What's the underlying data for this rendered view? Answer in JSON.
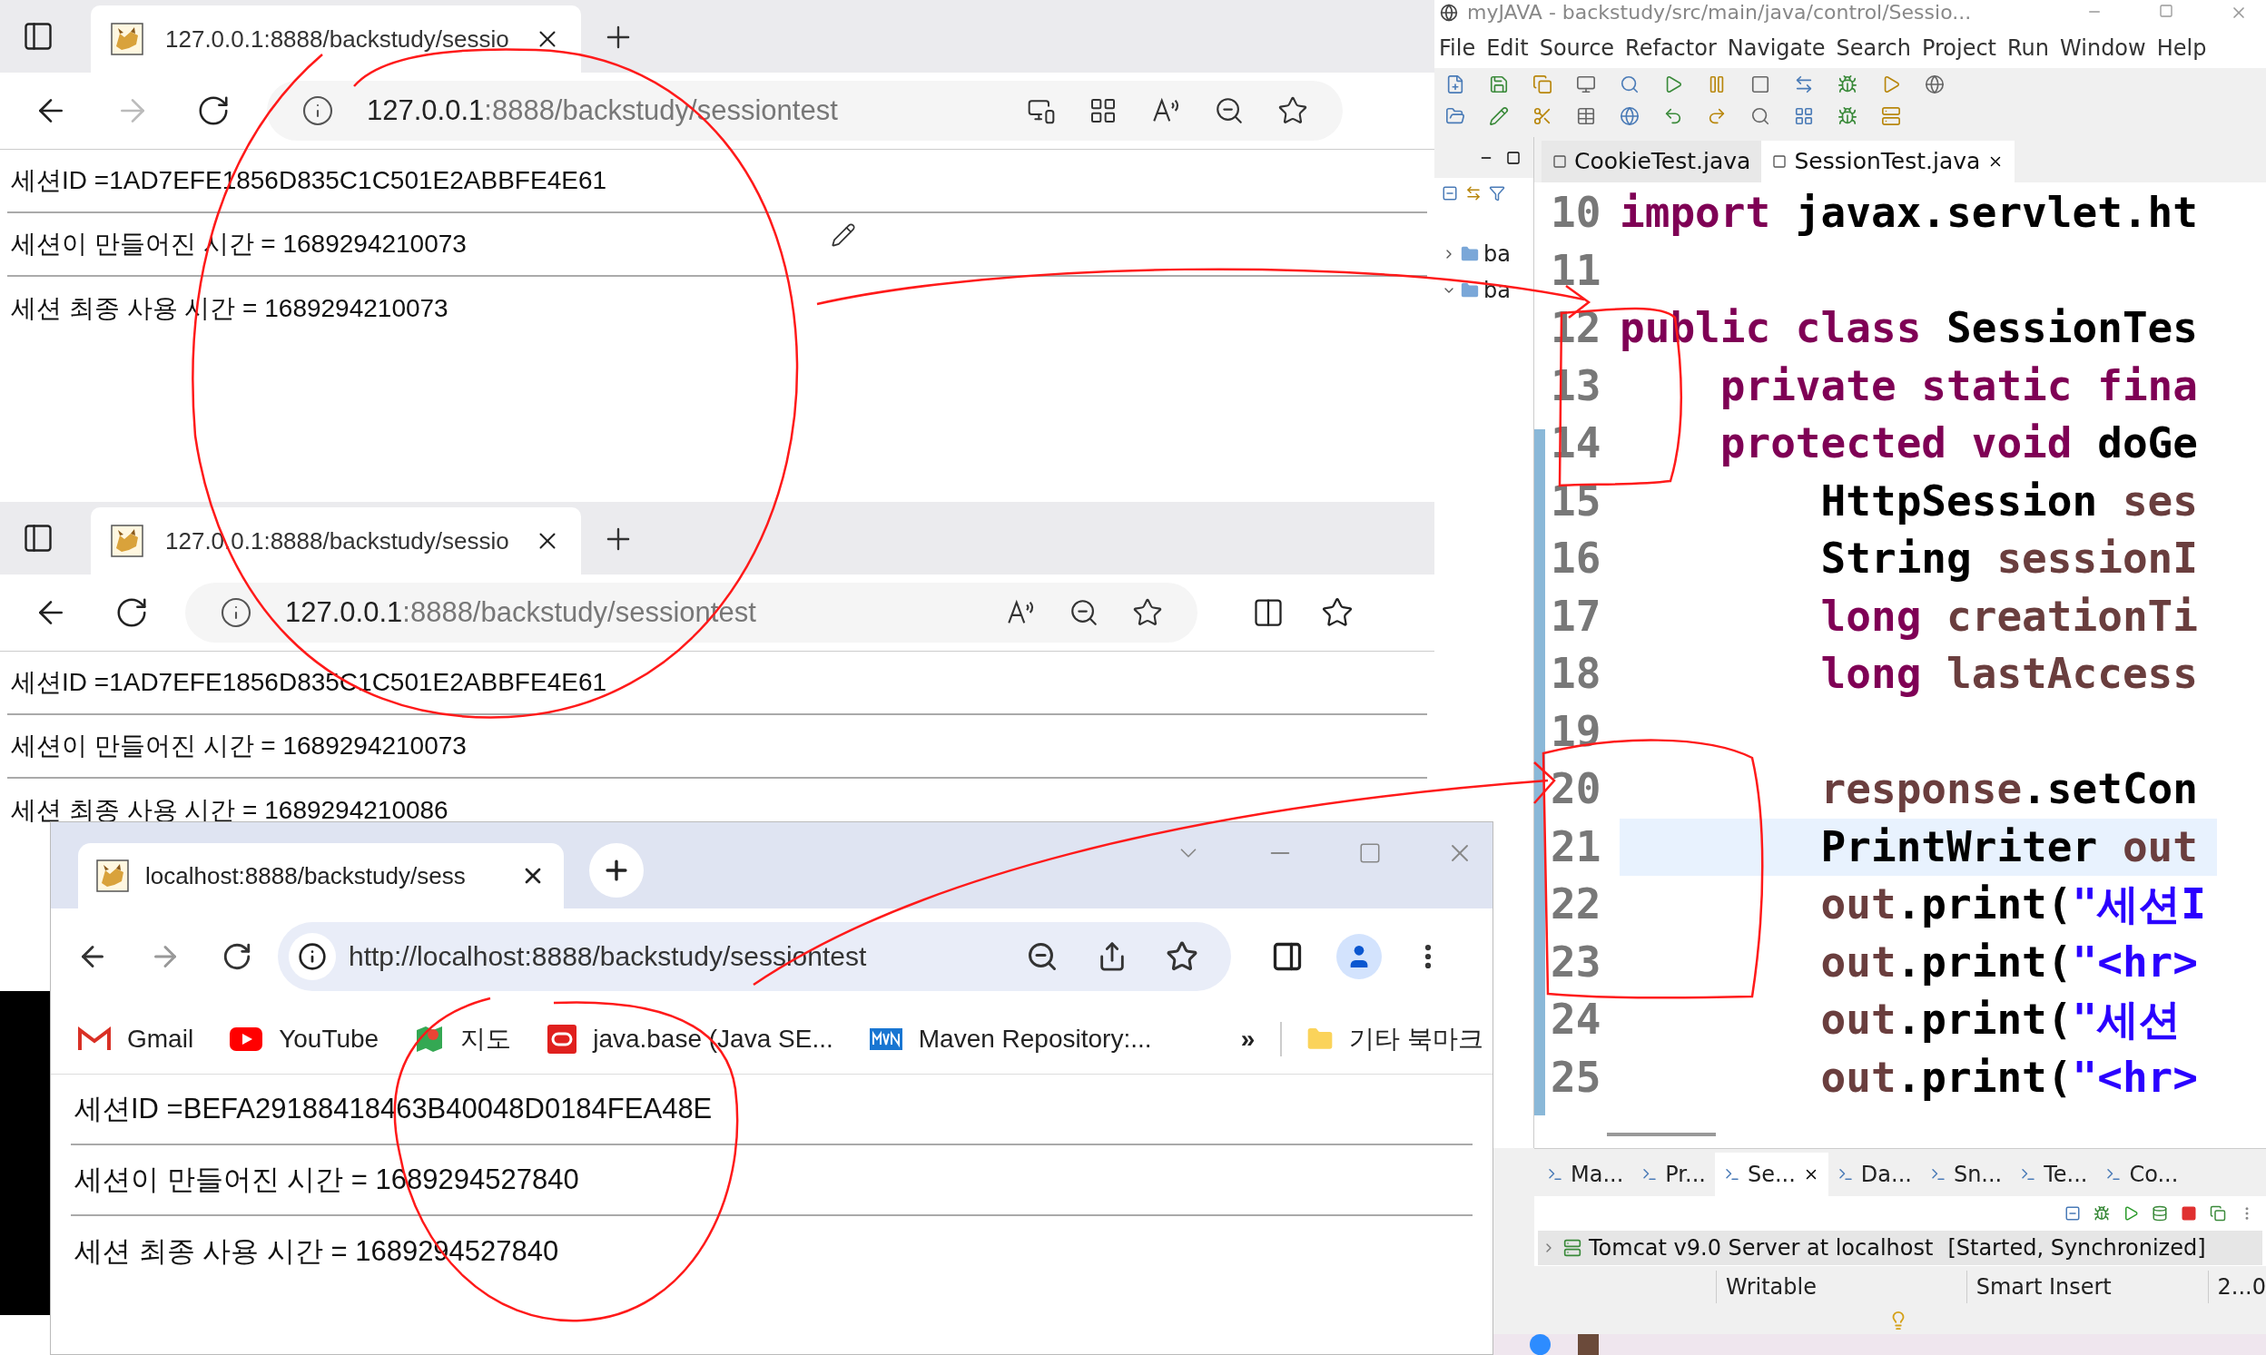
{
  "edge_windows": [
    {
      "kind": "full",
      "tab_title": "127.0.0.1:8888/backstudy/sessio",
      "url_host": "127.0.0.1",
      "url_rest": ":8888/backstudy/sessiontest",
      "lines": [
        "세션ID =1AD7EFE1856D835C1C501E2ABBFE4E61",
        "세션이 만들어진 시간 = 1689294210073",
        "세션 최종 사용 시간 = 1689294210073"
      ]
    },
    {
      "kind": "compact",
      "tab_title": "127.0.0.1:8888/backstudy/sessio",
      "url_host": "127.0.0.1",
      "url_rest": ":8888/backstudy/sessiontest",
      "lines": [
        "세션ID =1AD7EFE1856D835C1C501E2ABBFE4E61",
        "세션이 만들어진 시간 = 1689294210073",
        "세션 최종 사용 시간 = 1689294210086"
      ]
    }
  ],
  "chrome_window": {
    "tab_title": "localhost:8888/backstudy/sess",
    "url": "http://localhost:8888/backstudy/sessiontest",
    "bookmarks": [
      {
        "kind": "mail",
        "label": "Gmail"
      },
      {
        "kind": "video",
        "label": "YouTube"
      },
      {
        "kind": "map",
        "label": "지도"
      },
      {
        "kind": "ring",
        "label": "java.base (Java SE..."
      },
      {
        "kind": "repo",
        "label": "Maven Repository:..."
      }
    ],
    "more_bookmarks": "»",
    "other_bookmarks": "기타 북마크",
    "lines": [
      "세션ID =BEFA29188418463B40048D0184FEA48E",
      "세션이 만들어진 시간 = 1689294527840",
      "세션 최종 사용 시간 = 1689294527840"
    ]
  },
  "eclipse": {
    "title": "myJAVA - backstudy/src/main/java/control/Sessio...",
    "menu": [
      "File",
      "Edit",
      "Source",
      "Refactor",
      "Navigate",
      "Search",
      "Project",
      "Run",
      "Window",
      "Help"
    ],
    "tree": [
      {
        "label": "ba",
        "expanded": false
      },
      {
        "label": "ba",
        "expanded": true
      }
    ],
    "editor_tabs": [
      {
        "label": "CookieTest.java",
        "selected": false
      },
      {
        "label": "SessionTest.java",
        "selected": true
      }
    ],
    "code_lines": [
      {
        "number": "10",
        "current": false,
        "tokens": [
          {
            "text": "import",
            "kind": "keyword"
          },
          {
            "text": " javax.servlet.ht",
            "kind": "plain"
          }
        ]
      },
      {
        "number": "11",
        "current": false
      },
      {
        "number": "12",
        "current": false,
        "tokens": [
          {
            "text": "public class",
            "kind": "keyword"
          },
          {
            "text": " SessionTes",
            "kind": "plain"
          }
        ]
      },
      {
        "number": "13",
        "current": false,
        "tokens": [
          {
            "text": "    private static fina",
            "kind": "keyword"
          }
        ]
      },
      {
        "number": "14",
        "current": false,
        "tokens": [
          {
            "text": "    protected void",
            "kind": "keyword"
          },
          {
            "text": " doGe",
            "kind": "plain"
          }
        ]
      },
      {
        "number": "15",
        "current": false,
        "tokens": [
          {
            "text": "        HttpSession",
            "kind": "plain"
          },
          {
            "text": " ses",
            "kind": "variable"
          }
        ]
      },
      {
        "number": "16",
        "current": false,
        "tokens": [
          {
            "text": "        String",
            "kind": "plain"
          },
          {
            "text": " sessionI",
            "kind": "variable"
          }
        ]
      },
      {
        "number": "17",
        "current": false,
        "tokens": [
          {
            "text": "        long",
            "kind": "keyword"
          },
          {
            "text": " creationTi",
            "kind": "variable"
          }
        ]
      },
      {
        "number": "18",
        "current": false,
        "tokens": [
          {
            "text": "        long",
            "kind": "keyword"
          },
          {
            "text": " lastAccess",
            "kind": "variable"
          }
        ]
      },
      {
        "number": "19",
        "current": false
      },
      {
        "number": "20",
        "current": false,
        "tokens": [
          {
            "text": "        response",
            "kind": "variable"
          },
          {
            "text": ".setCon",
            "kind": "plain"
          }
        ]
      },
      {
        "number": "21",
        "current": true,
        "tokens": [
          {
            "text": "        PrintWriter",
            "kind": "plain"
          },
          {
            "text": " out",
            "kind": "variable"
          }
        ]
      },
      {
        "number": "22",
        "current": false,
        "tokens": [
          {
            "text": "        out",
            "kind": "variable"
          },
          {
            "text": ".print(",
            "kind": "plain"
          },
          {
            "text": "\"세션I",
            "kind": "string"
          }
        ]
      },
      {
        "number": "23",
        "current": false,
        "tokens": [
          {
            "text": "        out",
            "kind": "variable"
          },
          {
            "text": ".print(",
            "kind": "plain"
          },
          {
            "text": "\"<hr>",
            "kind": "string"
          }
        ]
      },
      {
        "number": "24",
        "current": false,
        "tokens": [
          {
            "text": "        out",
            "kind": "variable"
          },
          {
            "text": ".print(",
            "kind": "plain"
          },
          {
            "text": "\"세션",
            "kind": "string"
          }
        ]
      },
      {
        "number": "25",
        "current": false,
        "tokens": [
          {
            "text": "        out",
            "kind": "variable"
          },
          {
            "text": ".print(",
            "kind": "plain"
          },
          {
            "text": "\"<hr>",
            "kind": "string"
          }
        ]
      }
    ],
    "bottom_tabs": [
      {
        "label": "Ma...",
        "selected": false
      },
      {
        "label": "Pr...",
        "selected": false
      },
      {
        "label": "Se...",
        "selected": true
      },
      {
        "label": "Da...",
        "selected": false
      },
      {
        "label": "Sn...",
        "selected": false
      },
      {
        "label": "Te...",
        "selected": false
      },
      {
        "label": "Co...",
        "selected": false
      }
    ],
    "server": {
      "name": "Tomcat v9.0 Server at localhost",
      "state": "[Started, Synchronized]"
    },
    "status": [
      "Writable",
      "Smart Insert",
      "2...0"
    ]
  }
}
